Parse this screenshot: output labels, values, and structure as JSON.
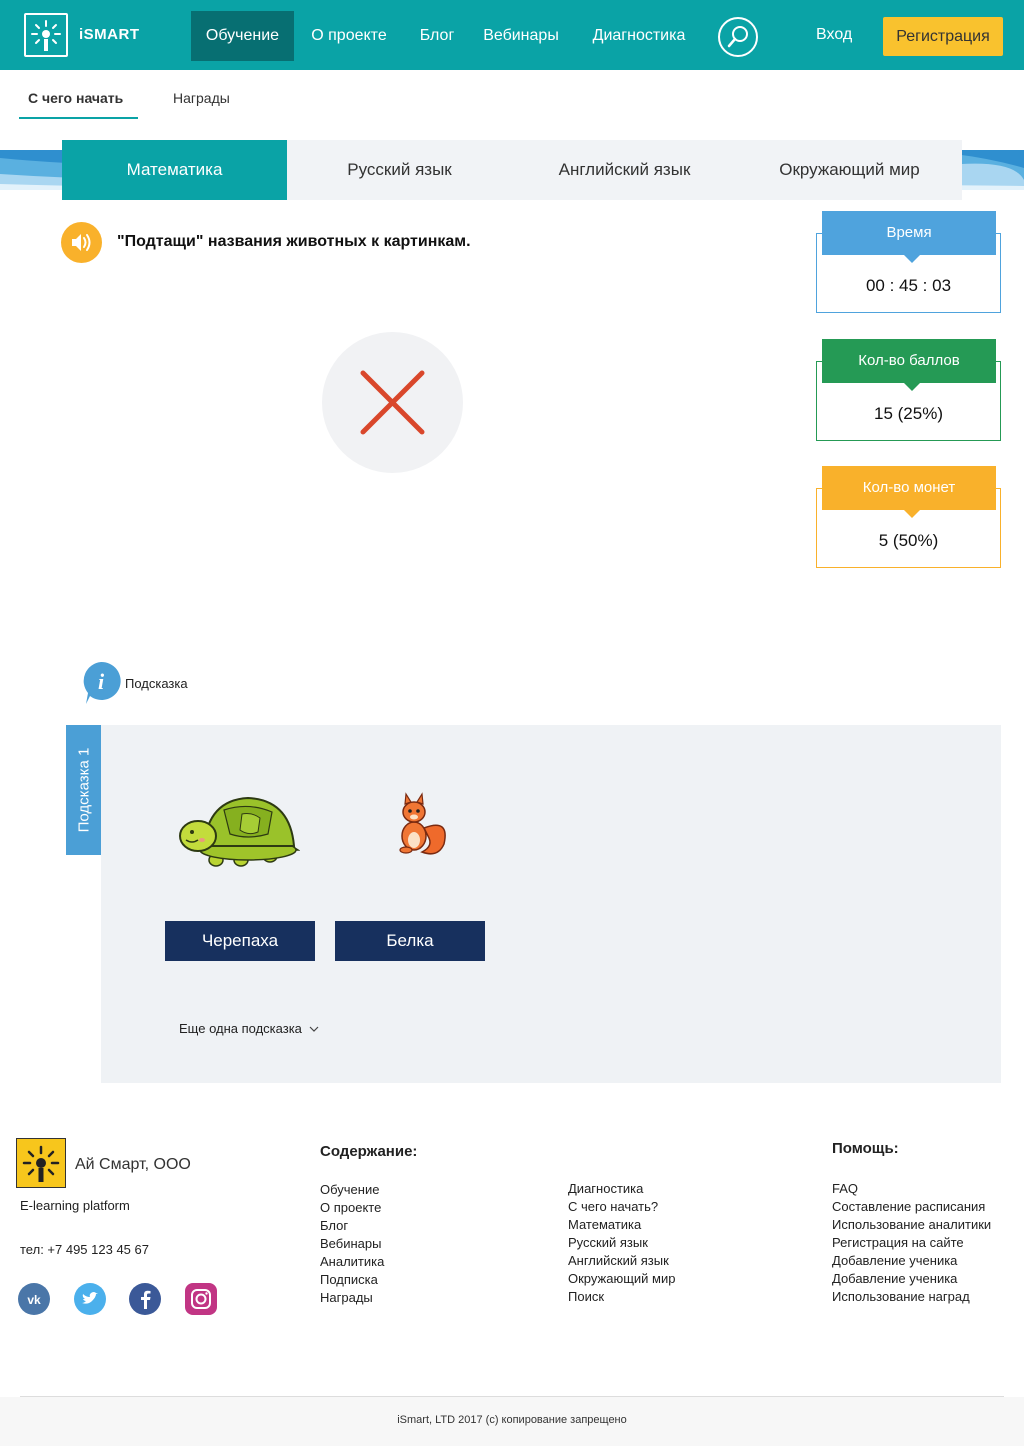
{
  "brand": {
    "name": "iSMART"
  },
  "nav": {
    "items": [
      "Обучение",
      "О проекте",
      "Блог",
      "Вебинары",
      "Диагностика"
    ],
    "login": "Вход",
    "register": "Регистрация"
  },
  "subnav": {
    "items": [
      "С чего начать",
      "Награды"
    ]
  },
  "subjects": [
    "Математика",
    "Русский язык",
    "Английский язык",
    "Окружающий мир"
  ],
  "task": {
    "instruction": "\"Подтащи\" названия животных к картинкам."
  },
  "stats": {
    "time": {
      "label": "Время",
      "value": "00 : 45 : 03",
      "color": "#4fa3dd"
    },
    "points": {
      "label": "Кол-во баллов",
      "value": "15 (25%)",
      "color": "#259a55"
    },
    "coins": {
      "label": "Кол-во монет",
      "value": "5 (50%)",
      "color": "#f9b12b"
    }
  },
  "hint": {
    "label": "Подсказка",
    "tab_label": "Подсказка 1",
    "words": [
      "Черепаха",
      "Белка"
    ],
    "more": "Еще одна подсказка"
  },
  "footer": {
    "company": "Ай Смарт, ООО",
    "tagline": "E-learning platform",
    "phone": "тел: +7 495 123 45 67",
    "content_heading": "Содержание:",
    "content_col1": [
      "Обучение",
      "О проекте",
      "Блог",
      "Вебинары",
      "Аналитика",
      "Подписка",
      "Награды"
    ],
    "content_col2": [
      "Диагностика",
      "С чего начать?",
      "Математика",
      "Русский язык",
      "Английский язык",
      "Окружающий мир",
      "Поиск"
    ],
    "help_heading": "Помощь:",
    "help_items": [
      "FAQ",
      "Составление расписания",
      "Использование аналитики",
      "Регистрация на сайте",
      "Добавление ученика",
      "Добавление ученика",
      "Использование наград"
    ],
    "copyright": "iSmart, LTD 2017 (c) копирование запрещено"
  },
  "colors": {
    "accent": "#0aa3a6",
    "accent_dark": "#076f72",
    "cta": "#f9c22e",
    "wrong": "#d9472b",
    "word_button": "#17305e"
  }
}
